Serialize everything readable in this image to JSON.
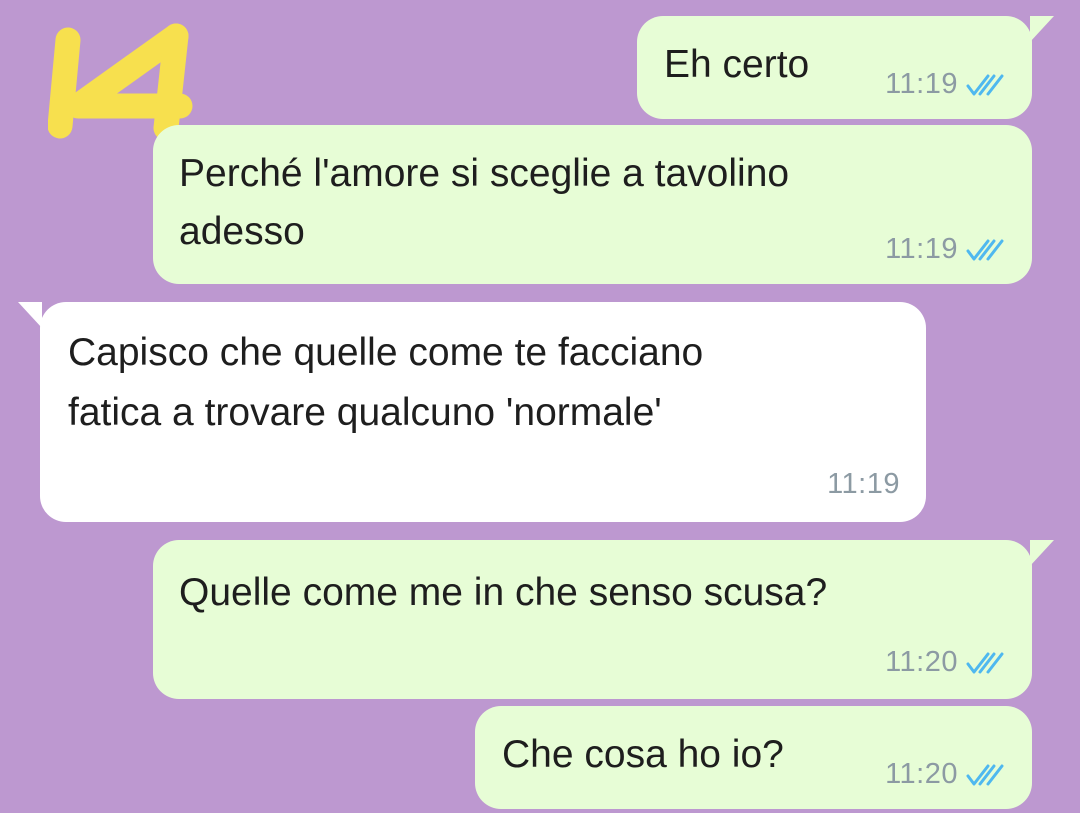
{
  "badge": {
    "number": "14",
    "color": "#f7e04e"
  },
  "colors": {
    "background": "#bd98d0",
    "outgoing_bubble": "#e7fdd6",
    "incoming_bubble": "#ffffff",
    "read_ticks": "#4fb8ef",
    "time_text": "#8c9aa3"
  },
  "messages": [
    {
      "direction": "outgoing",
      "text": "Eh certo",
      "time": "11:19",
      "status": "read"
    },
    {
      "direction": "outgoing",
      "lines": [
        "Perché l'amore si sceglie a tavolino",
        "adesso"
      ],
      "time": "11:19",
      "status": "read"
    },
    {
      "direction": "incoming",
      "lines": [
        "Capisco che quelle come te facciano",
        "fatica a trovare qualcuno 'normale'"
      ],
      "time": "11:19"
    },
    {
      "direction": "outgoing",
      "text": "Quelle come me in che senso scusa?",
      "time": "11:20",
      "status": "read"
    },
    {
      "direction": "outgoing",
      "text": "Che cosa ho io?",
      "time": "11:20",
      "status": "read"
    }
  ]
}
